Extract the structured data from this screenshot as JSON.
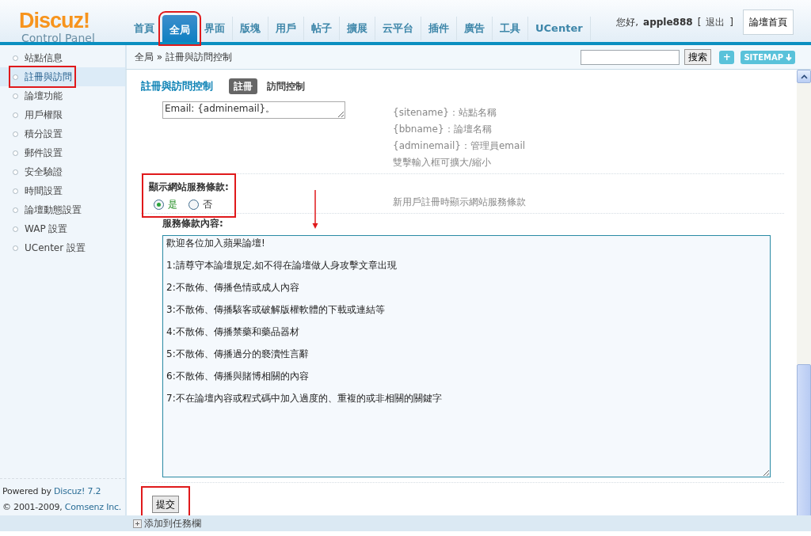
{
  "logo": {
    "name": "Discuz!",
    "subtitle": "Control Panel"
  },
  "nav_tabs": [
    {
      "label": "首頁",
      "selected": false,
      "highlighted": false
    },
    {
      "label": "全局",
      "selected": true,
      "highlighted": true
    },
    {
      "label": "界面",
      "selected": false,
      "highlighted": false
    },
    {
      "label": "版塊",
      "selected": false,
      "highlighted": false
    },
    {
      "label": "用戶",
      "selected": false,
      "highlighted": false
    },
    {
      "label": "帖子",
      "selected": false,
      "highlighted": false
    },
    {
      "label": "擴展",
      "selected": false,
      "highlighted": false
    },
    {
      "label": "云平台",
      "selected": false,
      "highlighted": false
    },
    {
      "label": "插件",
      "selected": false,
      "highlighted": false
    },
    {
      "label": "廣告",
      "selected": false,
      "highlighted": false
    },
    {
      "label": "工具",
      "selected": false,
      "highlighted": false
    },
    {
      "label": "UCenter",
      "selected": false,
      "highlighted": false
    }
  ],
  "user_bar": {
    "greeting": "您好,",
    "username": "apple888",
    "bracket_open": "[",
    "logout": "退出",
    "bracket_close": "]",
    "home_button": "論壇首頁"
  },
  "breadcrumb": "全局 » 註冊與訪問控制",
  "search": {
    "button": "搜索"
  },
  "add_button": "+",
  "sitemap_button": "SITEMAP",
  "sidebar": {
    "items": [
      {
        "label": "站點信息",
        "selected": false,
        "highlighted": false
      },
      {
        "label": "註冊與訪問",
        "selected": true,
        "highlighted": true
      },
      {
        "label": "論壇功能",
        "selected": false,
        "highlighted": false
      },
      {
        "label": "用戶權限",
        "selected": false,
        "highlighted": false
      },
      {
        "label": "積分設置",
        "selected": false,
        "highlighted": false
      },
      {
        "label": "郵件設置",
        "selected": false,
        "highlighted": false
      },
      {
        "label": "安全驗證",
        "selected": false,
        "highlighted": false
      },
      {
        "label": "時間設置",
        "selected": false,
        "highlighted": false
      },
      {
        "label": "論壇動態設置",
        "selected": false,
        "highlighted": false
      },
      {
        "label": "WAP 設置",
        "selected": false,
        "highlighted": false
      },
      {
        "label": "UCenter 設置",
        "selected": false,
        "highlighted": false
      }
    ]
  },
  "footer": {
    "powered_prefix": "Powered by",
    "powered_link": "Discuz! 7.2",
    "copyright_prefix": "© 2001-2009,",
    "copyright_link": "Comsenz Inc."
  },
  "page_title": "註冊與訪問控制",
  "sub_tabs": [
    {
      "label": "註冊",
      "selected": true
    },
    {
      "label": "訪問控制",
      "selected": false
    }
  ],
  "settings": [
    {
      "kind": "textarea",
      "value": "Email: {adminemail}。",
      "description": [
        "{sitename}：站點名稱",
        "{bbname}：論壇名稱",
        "{adminemail}：管理員email",
        "雙擊輸入框可擴大/縮小"
      ]
    },
    {
      "kind": "radio",
      "label": "顯示網站服務條款:",
      "highlighted": true,
      "options": [
        {
          "label": "是",
          "selected": true
        },
        {
          "label": "否",
          "selected": false
        }
      ],
      "description": [
        "新用戶註冊時顯示網站服務條款"
      ]
    },
    {
      "kind": "bigtext",
      "label": "服務條款內容:",
      "lines": [
        "歡迎各位加入蘋果論壇!",
        "1:請尊守本論壇規定,如不得在論壇做人身攻擊文章出現",
        "2:不散佈、傳播色情或成人內容",
        "3:不散佈、傳播駭客或破解版權軟體的下載或連結等",
        "4:不散佈、傳播禁藥和藥品器材",
        "5:不散佈、傳播過分的褻瀆性言辭",
        "6:不散佈、傳播與賭博相關的內容",
        "7:不在論壇內容或程式碼中加入過度的、重複的或非相關的關鍵字"
      ]
    }
  ],
  "submit": {
    "label": "提交",
    "highlighted": true
  },
  "taskbar_link": "添加到任務欄"
}
